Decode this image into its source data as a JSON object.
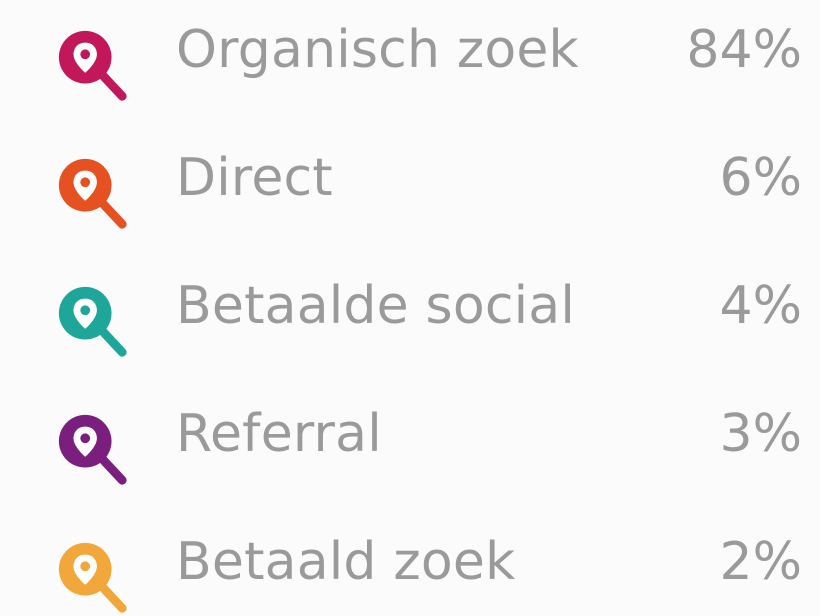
{
  "sources": [
    {
      "label": "Organisch zoek",
      "percent": "84%",
      "icon": "search-location-icon",
      "color": "#c2185b"
    },
    {
      "label": "Direct",
      "percent": "6%",
      "icon": "search-location-icon",
      "color": "#e65122"
    },
    {
      "label": "Betaalde social",
      "percent": "4%",
      "icon": "search-location-icon",
      "color": "#1fa69a"
    },
    {
      "label": "Referral",
      "percent": "3%",
      "icon": "search-location-icon",
      "color": "#7b1f7e"
    },
    {
      "label": "Betaald zoek",
      "percent": "2%",
      "icon": "search-location-icon",
      "color": "#f2a73b"
    }
  ]
}
